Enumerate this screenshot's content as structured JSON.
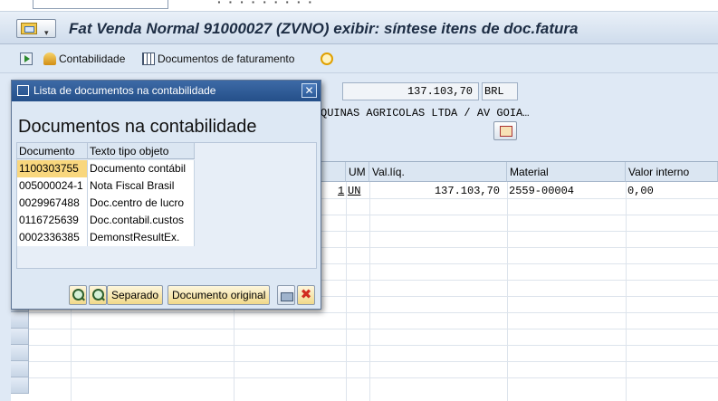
{
  "window": {
    "title": "Fat Venda Normal 91000027  (ZVNO) exibir: síntese itens de doc.fatura",
    "top_partial_text": "· · · · ·  ·  · · ·"
  },
  "toolbar": {
    "items": [
      {
        "label": "Contabilidade",
        "icon": "accounting-icon"
      },
      {
        "label": "Documentos de faturamento",
        "icon": "billing-docs-icon"
      }
    ]
  },
  "header": {
    "net_value": "137.103,70",
    "currency": "BRL",
    "customer": "QUINAS AGRICOLAS LTDA / AV GOIA…"
  },
  "grid": {
    "columns": [
      "UM",
      "Val.líq.",
      "Material",
      "Valor interno"
    ],
    "rows": [
      {
        "qty": "1",
        "um": "UN",
        "net_value": "137.103,70",
        "material": "2559-00004",
        "internal_value": "0,00"
      }
    ]
  },
  "popup": {
    "title": "Lista de documentos na contabilidade",
    "heading": "Documentos na contabilidade",
    "columns": [
      "Documento",
      "Texto tipo objeto"
    ],
    "rows": [
      {
        "doc": "1100303755",
        "text": "Documento contábil",
        "selected": true
      },
      {
        "doc": "005000024-1",
        "text": "Nota Fiscal Brasil",
        "selected": false
      },
      {
        "doc": "0029967488",
        "text": "Doc.centro de lucro",
        "selected": false
      },
      {
        "doc": "0116725639",
        "text": "Doc.contabil.custos",
        "selected": false
      },
      {
        "doc": "0002336385",
        "text": "DemonstResultEx.",
        "selected": false
      }
    ],
    "buttons": {
      "separado": "Separado",
      "original": "Documento original"
    }
  },
  "colors": {
    "selected_row": "#f9d77e",
    "title_bar": "#2b5a98",
    "background": "#dfe9f5"
  }
}
